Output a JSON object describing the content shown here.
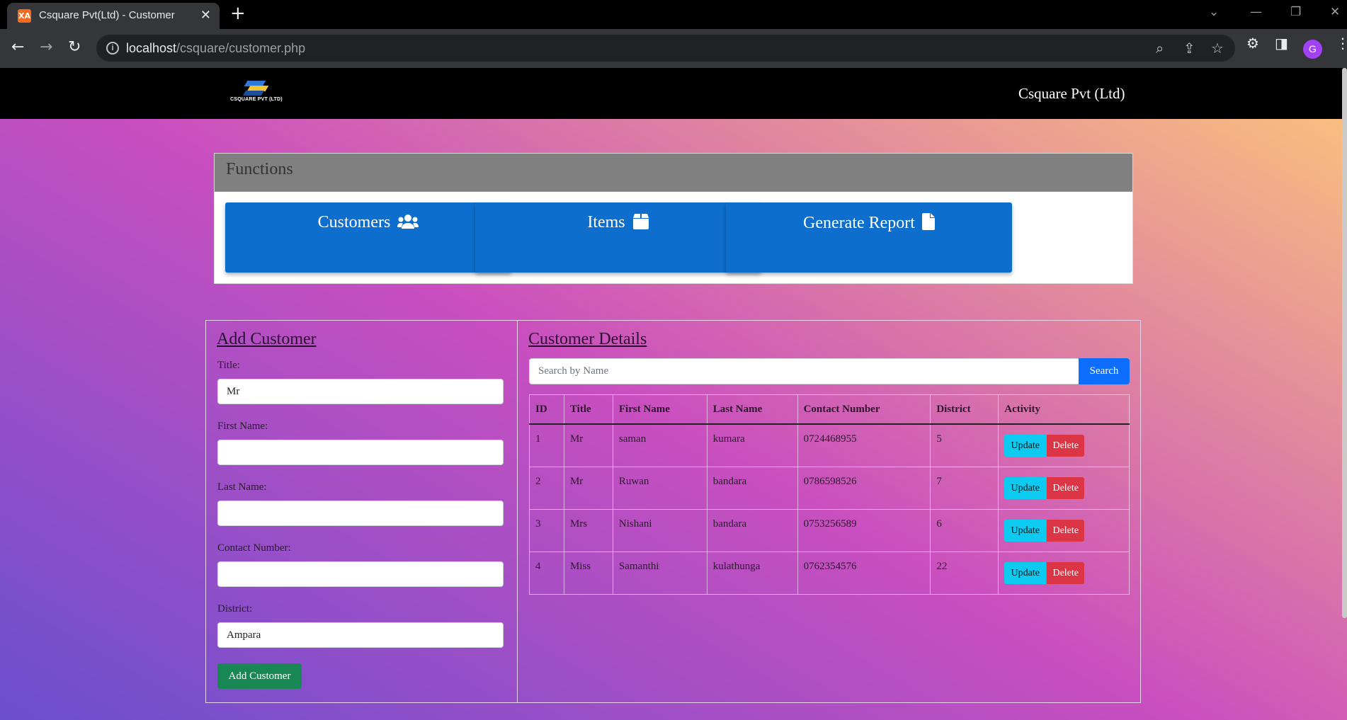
{
  "browser": {
    "tab_title": "Csquare Pvt(Ltd) - Customer",
    "tab_favicon": "XA",
    "url_host": "localhost",
    "url_path": "/csquare/customer.php",
    "profile_initial": "G"
  },
  "header": {
    "logo_text": "CSQUARE PVT (LTD)",
    "brand": "Csquare Pvt (Ltd)"
  },
  "functions": {
    "heading": "Functions",
    "buttons": [
      {
        "label": "Customers",
        "icon": "users-icon"
      },
      {
        "label": "Items",
        "icon": "box-icon"
      },
      {
        "label": "Generate Report",
        "icon": "file-icon"
      }
    ]
  },
  "add_customer": {
    "title": "Add Customer",
    "fields": {
      "title": {
        "label": "Title:",
        "value": "Mr"
      },
      "first_name": {
        "label": "First Name:",
        "value": ""
      },
      "last_name": {
        "label": "Last Name:",
        "value": ""
      },
      "contact": {
        "label": "Contact Number:",
        "value": ""
      },
      "district": {
        "label": "District:",
        "value": "Ampara"
      }
    },
    "submit": "Add Customer"
  },
  "customer_details": {
    "title": "Customer Details",
    "search_placeholder": "Search by Name",
    "search_button": "Search",
    "columns": [
      "ID",
      "Title",
      "First Name",
      "Last Name",
      "Contact Number",
      "District",
      "Activity"
    ],
    "rows": [
      {
        "id": "1",
        "title": "Mr",
        "first": "saman",
        "last": "kumara",
        "contact": "0724468955",
        "district": "5"
      },
      {
        "id": "2",
        "title": "Mr",
        "first": "Ruwan",
        "last": "bandara",
        "contact": "0786598526",
        "district": "7"
      },
      {
        "id": "3",
        "title": "Mrs",
        "first": "Nishani",
        "last": "bandara",
        "contact": "0753256589",
        "district": "6"
      },
      {
        "id": "4",
        "title": "Miss",
        "first": "Samanthi",
        "last": "kulathunga",
        "contact": "0762354576",
        "district": "22"
      }
    ],
    "update_label": "Update",
    "delete_label": "Delete"
  },
  "colors": {
    "primary": "#0d6ecd",
    "search_button": "#0d6efd",
    "update_button": "#0dcaf0",
    "delete_button": "#dc3545",
    "add_button": "#198754"
  }
}
